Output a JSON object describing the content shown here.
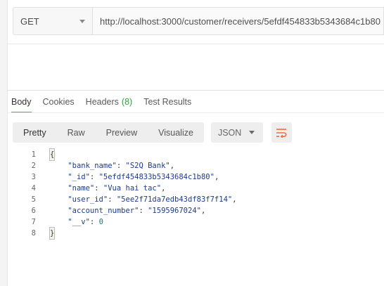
{
  "request": {
    "method": "GET",
    "url": "http://localhost:3000/customer/receivers/5efdf454833b5343684c1b80"
  },
  "response_tabs": [
    {
      "label": "Body",
      "count": ""
    },
    {
      "label": "Cookies",
      "count": ""
    },
    {
      "label": "Headers",
      "count": "(8)"
    },
    {
      "label": "Test Results",
      "count": ""
    }
  ],
  "view_modes": [
    "Pretty",
    "Raw",
    "Preview",
    "Visualize"
  ],
  "format": "JSON",
  "code_lines": [
    {
      "n": "1",
      "text": "{"
    },
    {
      "n": "2",
      "key": "\"bank_name\"",
      "value": "\"S2Q Bank\"",
      "comma": ","
    },
    {
      "n": "3",
      "key": "\"_id\"",
      "value": "\"5efdf454833b5343684c1b80\"",
      "comma": ","
    },
    {
      "n": "4",
      "key": "\"name\"",
      "value": "\"Vua hai tac\"",
      "comma": ","
    },
    {
      "n": "5",
      "key": "\"user_id\"",
      "value": "\"5ee2f71da7edb43df83f7f14\"",
      "comma": ","
    },
    {
      "n": "6",
      "key": "\"account_number\"",
      "value": "\"1595967024\"",
      "comma": ","
    },
    {
      "n": "7",
      "key": "\"__v\"",
      "value": "0",
      "comma": ""
    },
    {
      "n": "8",
      "text": "}"
    }
  ],
  "colors": {
    "accent": "#f26b3a",
    "count": "#3c9a46",
    "string": "#1c3b8a",
    "number": "#1a7a7a"
  }
}
